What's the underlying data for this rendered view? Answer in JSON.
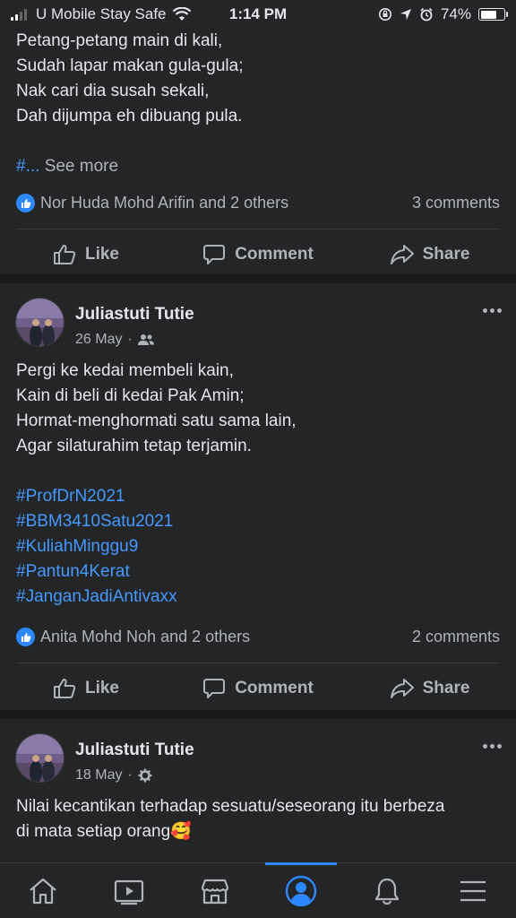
{
  "status_bar": {
    "carrier": "U Mobile Stay Safe",
    "time": "1:14 PM",
    "battery": "74%",
    "battery_level": 0.74
  },
  "post1": {
    "lines": [
      "Petang-petang main di kali,",
      "Sudah lapar makan gula-gula;",
      "Nak cari dia susah sekali,",
      "Dah dijumpa eh dibuang pula."
    ],
    "truncated_prefix": "#...",
    "see_more": "See more",
    "reactors": "Nor Huda Mohd Arifin and 2 others",
    "comments": "3 comments"
  },
  "post2": {
    "author": "Juliastuti Tutie",
    "date": "26 May",
    "privacy_separator": "·",
    "privacy_icon": "friends-icon",
    "lines": [
      "Pergi ke kedai membeli kain,",
      "Kain di beli di kedai Pak Amin;",
      "Hormat-menghormati satu sama lain,",
      "Agar silaturahim tetap terjamin."
    ],
    "hashtags": [
      "#ProfDrN2021",
      "#BBM3410Satu2021",
      "#KuliahMinggu9",
      "#Pantun4Kerat",
      "#JanganJadiAntivaxx"
    ],
    "reactors": "Anita Mohd Noh and 2 others",
    "comments": "2 comments"
  },
  "post3": {
    "author": "Juliastuti Tutie",
    "date": "18 May",
    "privacy_separator": "·",
    "privacy_icon": "gear-icon",
    "lines": [
      "Nilai kecantikan terhadap sesuatu/seseorang itu berbeza",
      "di mata setiap orang"
    ],
    "emoji": "🥰"
  },
  "actions": {
    "like": "Like",
    "comment": "Comment",
    "share": "Share"
  },
  "bottom_nav": {
    "items": [
      "home-icon",
      "watch-icon",
      "marketplace-icon",
      "profile-icon",
      "notifications-icon",
      "menu-icon"
    ],
    "active": "profile-icon"
  },
  "colors": {
    "background": "#18191a",
    "card": "#242526",
    "text": "#e4e6eb",
    "secondary": "#b0b3b8",
    "accent": "#2d88ff",
    "hashtag": "#4599ff"
  }
}
